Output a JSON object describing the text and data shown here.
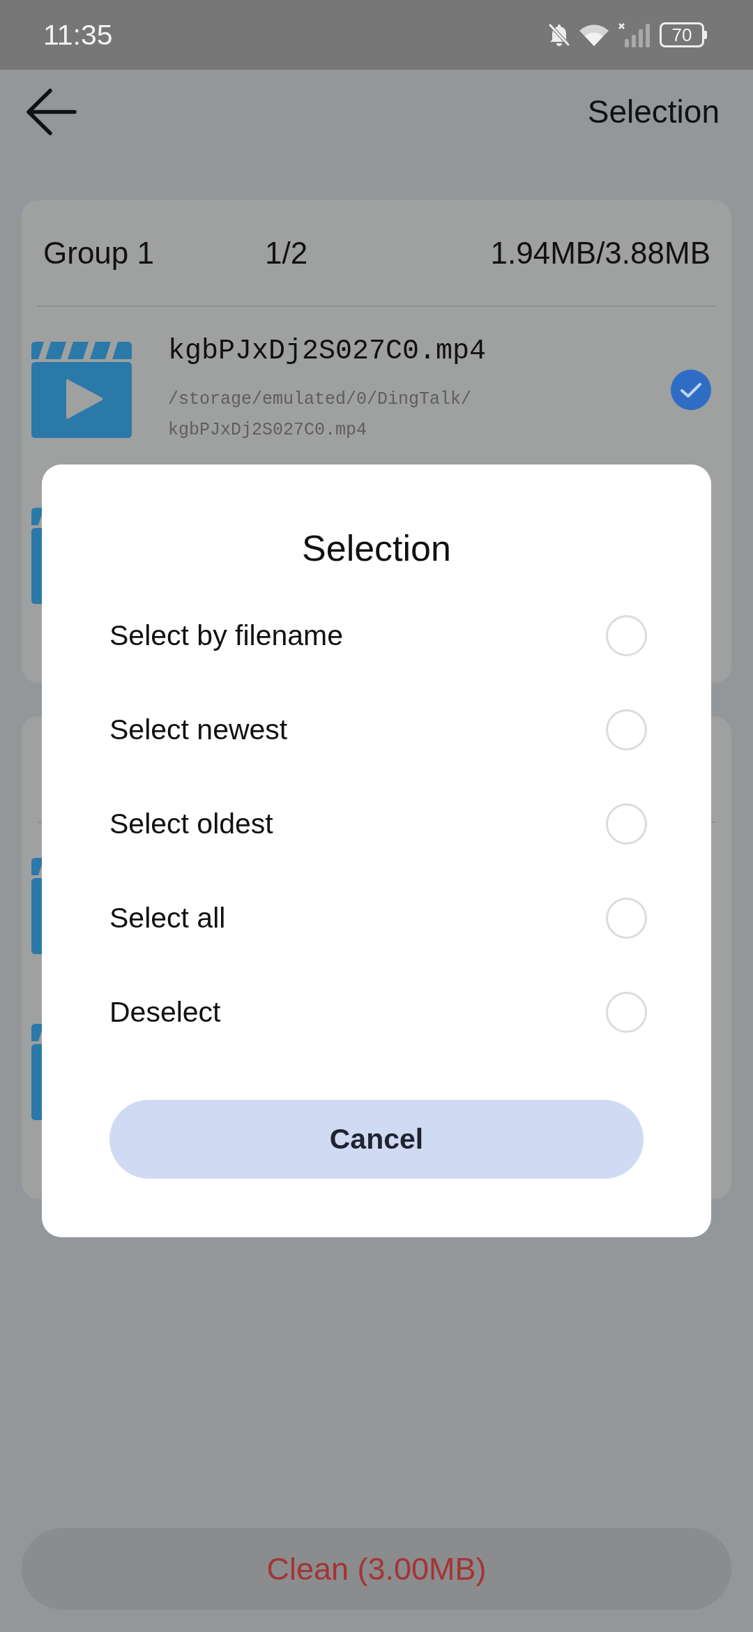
{
  "status_bar": {
    "time": "11:35",
    "battery": "70"
  },
  "header": {
    "title": "Selection"
  },
  "groups": [
    {
      "title": "Group 1",
      "count": "1/2",
      "size": "1.94MB/3.88MB",
      "files": [
        {
          "kind": "video",
          "name": "kgbPJxDj2S027C0.mp4",
          "path": "/storage/emulated/0/DingTalk/kgbPJxDj2S027C0.mp4",
          "selected": true
        },
        {
          "kind": "video"
        }
      ]
    },
    {
      "files": [
        {
          "kind": "video"
        },
        {
          "kind": "video"
        }
      ]
    }
  ],
  "dialog": {
    "title": "Selection",
    "options": [
      {
        "label": "Select by filename",
        "selected": false
      },
      {
        "label": "Select newest",
        "selected": false
      },
      {
        "label": "Select oldest",
        "selected": false
      },
      {
        "label": "Select all",
        "selected": false
      },
      {
        "label": "Deselect",
        "selected": false
      }
    ],
    "cancel": "Cancel"
  },
  "clean_button": "Clean (3.00MB)"
}
